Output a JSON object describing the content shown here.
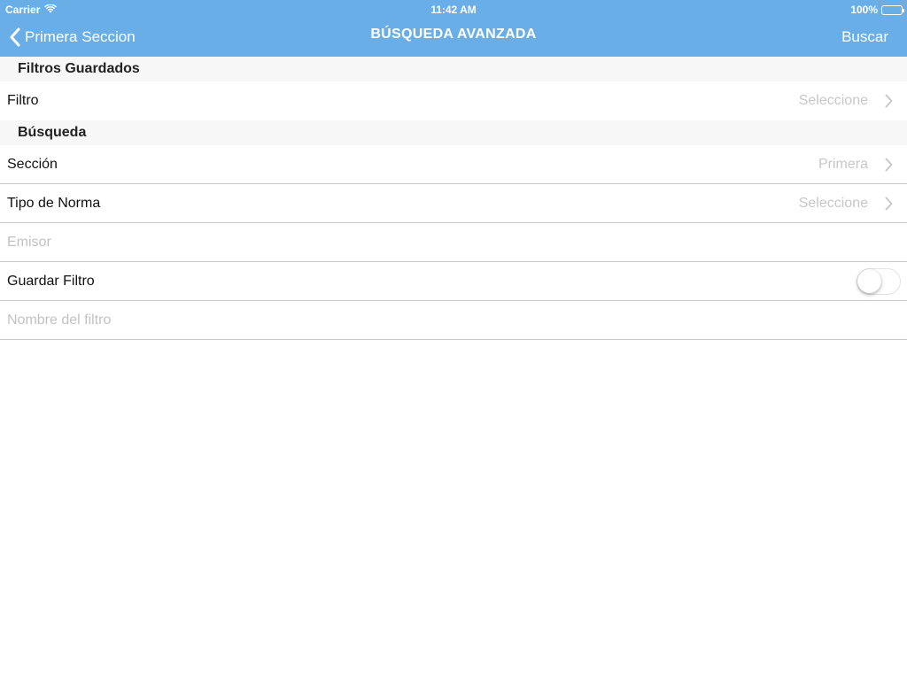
{
  "status_bar": {
    "carrier": "Carrier",
    "time": "11:42 AM",
    "battery": "100%",
    "wifi_icon": "wifi-icon",
    "battery_icon": "battery-icon",
    "battery_level": 1.0
  },
  "nav": {
    "back_label": "Primera Seccion",
    "title": "BÚSQUEDA AVANZADA",
    "action_label": "Buscar",
    "back_icon": "chevron-left-icon"
  },
  "sections": {
    "saved_filters": {
      "header": "Filtros Guardados",
      "filter_row": {
        "label": "Filtro",
        "value": "Seleccione"
      }
    },
    "search": {
      "header": "Búsqueda",
      "section_row": {
        "label": "Sección",
        "value": "Primera"
      },
      "norm_type_row": {
        "label": "Tipo de Norma",
        "value": "Seleccione"
      },
      "issuer_field": {
        "placeholder": "Emisor"
      },
      "save_filter_row": {
        "label": "Guardar Filtro",
        "toggle_on": false
      },
      "filter_name_field": {
        "placeholder": "Nombre del filtro"
      }
    }
  },
  "colors": {
    "nav_background": "#6aaee8",
    "section_background": "#f7f7f7",
    "separator": "#c8c8c8",
    "placeholder_text": "#c2c2c2"
  }
}
